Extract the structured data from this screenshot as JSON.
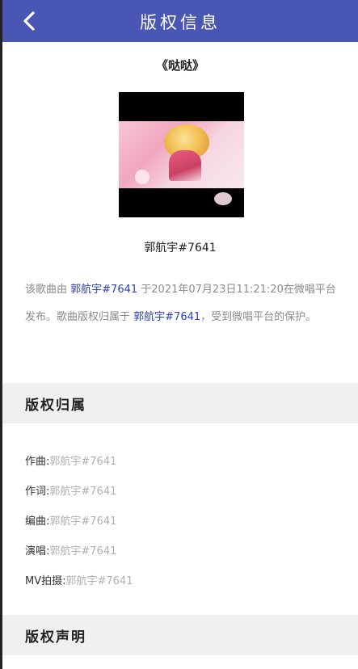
{
  "header": {
    "title": "版权信息",
    "back_icon": "chevron-left-icon"
  },
  "song": {
    "title": "《哒哒》",
    "artist": "郭航宇#7641",
    "cover": "album-cover-image"
  },
  "description": {
    "p1": "该歌曲由",
    "author1": "郭航宇#7641",
    "p2": "于2021年07月23日11:21:20在微唱平台发布。歌曲版权归属于",
    "author2": "郭航宇#7641",
    "p3": "，受到微唱平台的保护。"
  },
  "sections": {
    "ownership": "版权归属",
    "statement": "版权声明"
  },
  "credits": [
    {
      "label": "作曲:",
      "value": "郭航宇#7641"
    },
    {
      "label": "作词:",
      "value": "郭航宇#7641"
    },
    {
      "label": "编曲:",
      "value": "郭航宇#7641"
    },
    {
      "label": "演唱:",
      "value": "郭航宇#7641"
    },
    {
      "label": "MV拍摄:",
      "value": "郭航宇#7641"
    }
  ],
  "colors": {
    "header": "#4a56b3",
    "link": "#2c3fb3",
    "section_bg": "#f0f0f0"
  }
}
